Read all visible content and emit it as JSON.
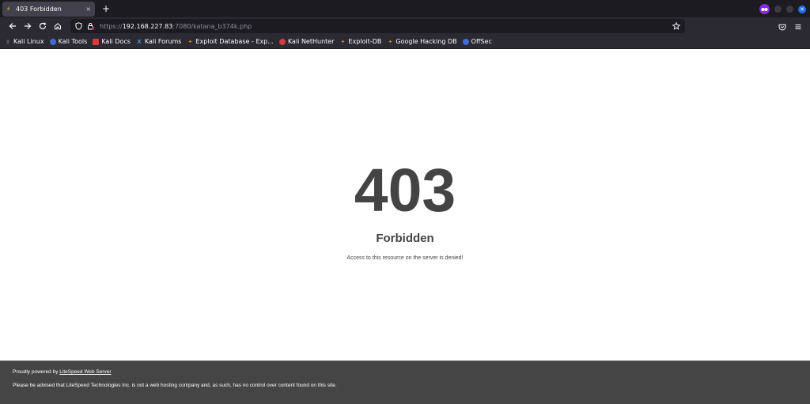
{
  "tab": {
    "title": "403 Forbidden",
    "favicon": "lightning-icon",
    "close": "×"
  },
  "newtab_label": "+",
  "address": {
    "scheme": "https://",
    "host": "192.168.227.83",
    "rest": ":7080/katana_b374k.php"
  },
  "bookmarks": [
    {
      "label": "Kali Linux",
      "icon": "kali-dragon-icon",
      "color": "#cfcfcf"
    },
    {
      "label": "Kali Tools",
      "icon": "kali-tools-icon",
      "color": "#3d6dd6"
    },
    {
      "label": "Kali Docs",
      "icon": "kali-docs-icon",
      "color": "#d63b3b"
    },
    {
      "label": "Kali Forums",
      "icon": "kali-forums-icon",
      "color": "#4a90e2"
    },
    {
      "label": "Exploit Database - Exp...",
      "icon": "exploit-db-icon",
      "color": "#e07b20"
    },
    {
      "label": "Kali NetHunter",
      "icon": "nethunter-icon",
      "color": "#d63b3b"
    },
    {
      "label": "Exploit-DB",
      "icon": "exploit-db-icon",
      "color": "#e07b20"
    },
    {
      "label": "Google Hacking DB",
      "icon": "ghdb-icon",
      "color": "#e07b20"
    },
    {
      "label": "OffSec",
      "icon": "offsec-icon",
      "color": "#3d6dd6"
    }
  ],
  "page": {
    "code": "403",
    "label": "Forbidden",
    "description": "Access to this resource on the server is denied!"
  },
  "footer": {
    "powered_prefix": "Proudly powered by ",
    "powered_link": "LiteSpeed Web Server",
    "disclaimer": "Please be advised that LiteSpeed Technologies Inc. is not a web hosting company and, as such, has no control over content found on this site."
  }
}
